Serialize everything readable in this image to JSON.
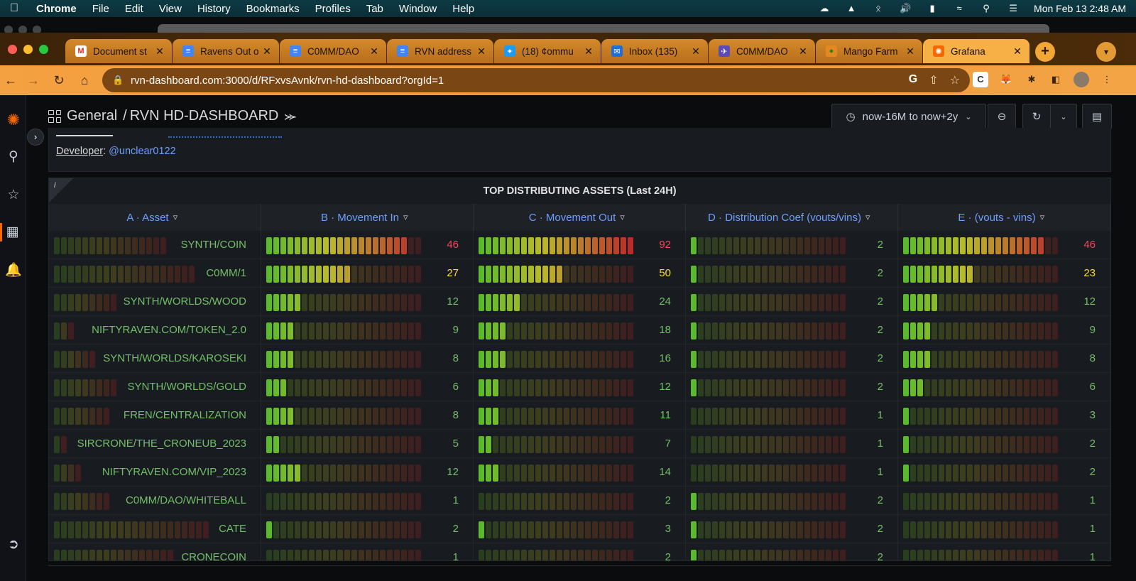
{
  "menubar": {
    "app": "Chrome",
    "items": [
      "File",
      "Edit",
      "View",
      "History",
      "Bookmarks",
      "Profiles",
      "Tab",
      "Window",
      "Help"
    ],
    "clock": "Mon Feb 13  2:48 AM"
  },
  "tabs": [
    {
      "title": "Document st",
      "icon": "gmail-icon",
      "color": "#ffffff",
      "glyph": "M",
      "glyphColor": "#d93025"
    },
    {
      "title": "Ravens Out o",
      "icon": "docs-icon",
      "color": "#4285f4",
      "glyph": "≡",
      "glyphColor": "#ffffff"
    },
    {
      "title": "C0MM/DAO",
      "icon": "docs-icon",
      "color": "#4285f4",
      "glyph": "≡",
      "glyphColor": "#ffffff"
    },
    {
      "title": "RVN address",
      "icon": "docs-icon",
      "color": "#4285f4",
      "glyph": "≡",
      "glyphColor": "#ffffff"
    },
    {
      "title": "(18) ¢ommu",
      "icon": "twitter-icon",
      "color": "#1d9bf0",
      "glyph": "✦",
      "glyphColor": "#ffffff"
    },
    {
      "title": "Inbox (135)",
      "icon": "mail-icon",
      "color": "#1e6fd9",
      "glyph": "✉",
      "glyphColor": "#ffffff"
    },
    {
      "title": "C0MM/DAO",
      "icon": "raven-icon",
      "color": "#5b4bb7",
      "glyph": "✈",
      "glyphColor": "#ffffff"
    },
    {
      "title": "Mango Farm",
      "icon": "mango-icon",
      "color": "#e28a1f",
      "glyph": "●",
      "glyphColor": "#3a7d1b"
    },
    {
      "title": "Grafana",
      "icon": "grafana-icon",
      "color": "#f46800",
      "glyph": "✺",
      "glyphColor": "#ffffff"
    }
  ],
  "address": {
    "url": "rvn-dashboard.com:3000/d/RFxvsAvnk/rvn-hd-dashboard?orgId=1"
  },
  "grafana": {
    "breadcrumb_root": "General",
    "breadcrumb_sep": "/",
    "dashboard_title": "RVN HD-DASHBOARD",
    "time_range": "now-16M to now+2y",
    "developer_label": "Developer",
    "developer_handle": "@unclear0122"
  },
  "table": {
    "title": "TOP DISTRIBUTING ASSETS (Last 24H)",
    "info": "i",
    "columns": [
      "A · Asset",
      "B · Movement In",
      "C · Movement Out",
      "D · Distribution Coef (vouts/vins)",
      "E · (vouts - vins)"
    ],
    "max": {
      "asset": 25,
      "b": 50,
      "c": 92,
      "d": 50,
      "e": 50
    },
    "rows": [
      {
        "asset": "SYNTH/COIN",
        "b": 46,
        "c": 92,
        "d": 2,
        "e": 46
      },
      {
        "asset": "C0MM/1",
        "b": 27,
        "c": 50,
        "d": 2,
        "e": 23
      },
      {
        "asset": "SYNTH/WORLDS/WOOD",
        "b": 12,
        "c": 24,
        "d": 2,
        "e": 12
      },
      {
        "asset": "NIFTYRAVEN.COM/TOKEN_2.0",
        "b": 9,
        "c": 18,
        "d": 2,
        "e": 9
      },
      {
        "asset": "SYNTH/WORLDS/KAROSEKI",
        "b": 8,
        "c": 16,
        "d": 2,
        "e": 8
      },
      {
        "asset": "SYNTH/WORLDS/GOLD",
        "b": 6,
        "c": 12,
        "d": 2,
        "e": 6
      },
      {
        "asset": "FREN/CENTRALIZATION",
        "b": 8,
        "c": 11,
        "d": 1,
        "e": 3
      },
      {
        "asset": "SIRCRONE/THE_CRONEUB_2023",
        "b": 5,
        "c": 7,
        "d": 1,
        "e": 2
      },
      {
        "asset": "NIFTYRAVEN.COM/VIP_2023",
        "b": 12,
        "c": 14,
        "d": 1,
        "e": 2
      },
      {
        "asset": "C0MM/DAO/WHITEBALL",
        "b": 1,
        "c": 2,
        "d": 2,
        "e": 1
      },
      {
        "asset": "CATE",
        "b": 2,
        "c": 3,
        "d": 2,
        "e": 1
      },
      {
        "asset": "CRONECOIN",
        "b": 1,
        "c": 2,
        "d": 2,
        "e": 1
      }
    ]
  },
  "colors": {
    "accent_link": "#6e9fff",
    "green": "#73bf69",
    "yellow": "#fade2a",
    "red": "#f2495c",
    "orange_chrome": "#f4a141"
  }
}
